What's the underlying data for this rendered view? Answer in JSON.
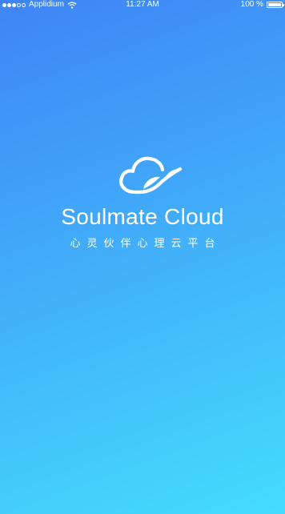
{
  "status_bar": {
    "signal_bars_filled": 3,
    "signal_bars_total": 5,
    "signal_icon": "signal-dots-icon",
    "carrier": "Applidium",
    "wifi_icon": "wifi-icon",
    "time": "11:27 AM",
    "battery_percent_label": "100 %",
    "battery_level": 1.0,
    "battery_icon": "battery-icon"
  },
  "splash": {
    "logo_icon": "cloud-hand-logo",
    "app_name": "Soulmate Cloud",
    "subtitle": "心灵伙伴心理云平台"
  },
  "colors": {
    "background_top": "#3f84f6",
    "background_bottom": "#44dcfd",
    "foreground": "#ffffff"
  }
}
